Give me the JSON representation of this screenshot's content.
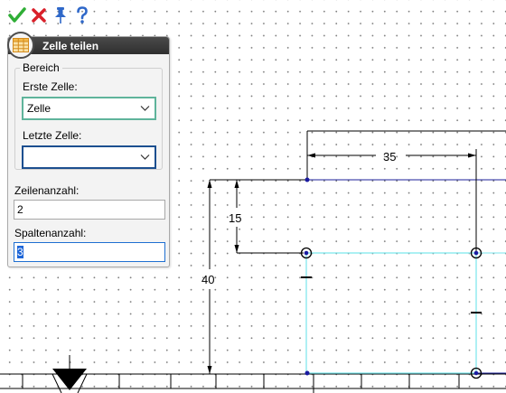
{
  "toolbar": {
    "icons": [
      "checkmark-icon",
      "close-icon",
      "pin-icon",
      "help-icon"
    ],
    "colors": {
      "confirm": "#2fae36",
      "cancel": "#d9202a",
      "pin": "#2f68c9",
      "help": "#2f68c9"
    }
  },
  "dialog": {
    "title": "Zelle teilen",
    "group_title": "Bereich",
    "first_cell_label": "Erste Zelle:",
    "first_cell_value": "Zelle",
    "last_cell_label": "Letzte Zelle:",
    "last_cell_value": "",
    "rows_label": "Zeilenanzahl:",
    "rows_value": "2",
    "cols_label": "Spaltenanzahl:",
    "cols_value": "3"
  },
  "drawing": {
    "dimensions": [
      "35",
      "15",
      "40"
    ],
    "colors": {
      "sketch_line": "#1b1f9a",
      "selection": "#79e6ec",
      "dimension": "#000000",
      "point": "#1a1aa0"
    }
  }
}
